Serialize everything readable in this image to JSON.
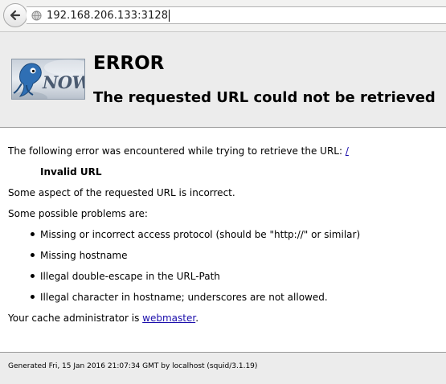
{
  "browser": {
    "url": "192.168.206.133:3128"
  },
  "header": {
    "logo_text": "NOW",
    "title": "ERROR",
    "subtitle": "The requested URL could not be retrieved"
  },
  "content": {
    "intro_text": "The following error was encountered while trying to retrieve the URL: ",
    "intro_link": "/",
    "error_name": "Invalid URL",
    "description": "Some aspect of the requested URL is incorrect.",
    "problems_heading": "Some possible problems are:",
    "problems": [
      "Missing or incorrect access protocol (should be \"http://\" or similar)",
      "Missing hostname",
      "Illegal double-escape in the URL-Path",
      "Illegal character in hostname; underscores are not allowed."
    ],
    "admin_prefix": "Your cache administrator is ",
    "admin_link": "webmaster",
    "admin_suffix": "."
  },
  "footer": {
    "generated": "Generated Fri, 15 Jan 2016 21:07:34 GMT by localhost (squid/3.1.19)"
  },
  "colors": {
    "link": "#1a0dab",
    "header_bg": "#ececec"
  }
}
